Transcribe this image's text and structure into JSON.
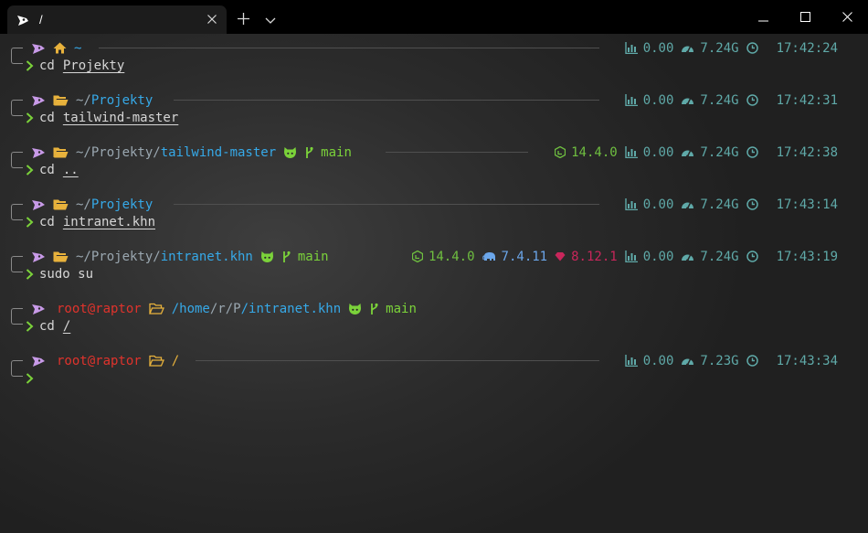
{
  "titlebar": {
    "tab_title": "/",
    "tab_icon": "terminal-shell-icon",
    "new_tab_icon": "plus-icon",
    "dropdown_icon": "chevron-down-icon",
    "minimize_icon": "minimize-icon",
    "maximize_icon": "maximize-icon",
    "close_icon": "close-icon"
  },
  "colors": {
    "path": "#36a9e8",
    "home": "#e8b23c",
    "git": "#7bd23a",
    "root": "#e0332c",
    "stats": "#5fa9a8",
    "node": "#6fbf40",
    "php": "#6ba6ea",
    "ruby": "#c8265b"
  },
  "prompts": [
    {
      "home_glyph": "~",
      "cmd": "cd",
      "arg": "Projekty",
      "cpu": "0.00",
      "mem": "7.24G",
      "time": "17:42:24"
    },
    {
      "path_prefix": "~/",
      "path_main": "Projekty",
      "cmd": "cd",
      "arg": "tailwind-master",
      "cpu": "0.00",
      "mem": "7.24G",
      "time": "17:42:31"
    },
    {
      "path_prefix": "~/Projekty/",
      "path_main": "tailwind-master",
      "branch": "main",
      "node": "14.4.0",
      "cmd": "cd",
      "arg": "..",
      "cpu": "0.00",
      "mem": "7.24G",
      "time": "17:42:38"
    },
    {
      "path_prefix": "~/",
      "path_main": "Projekty",
      "cmd": "cd",
      "arg": "intranet.khn",
      "cpu": "0.00",
      "mem": "7.24G",
      "time": "17:43:14"
    },
    {
      "path_prefix": "~/Projekty/",
      "path_main": "intranet.khn",
      "branch": "main",
      "node": "14.4.0",
      "php": "7.4.11",
      "ruby": "8.12.1",
      "cmd": "sudo su",
      "cpu": "0.00",
      "mem": "7.24G",
      "time": "17:43:19"
    },
    {
      "user": "root@raptor",
      "path_seg1": "/home",
      "path_seg2": "/r",
      "path_seg3": "/P",
      "path_seg4": "/intranet.khn",
      "branch": "main",
      "cmd": "cd",
      "arg": "/"
    },
    {
      "user": "root@raptor",
      "path": "/",
      "cpu": "0.00",
      "mem": "7.23G",
      "time": "17:43:34"
    }
  ]
}
